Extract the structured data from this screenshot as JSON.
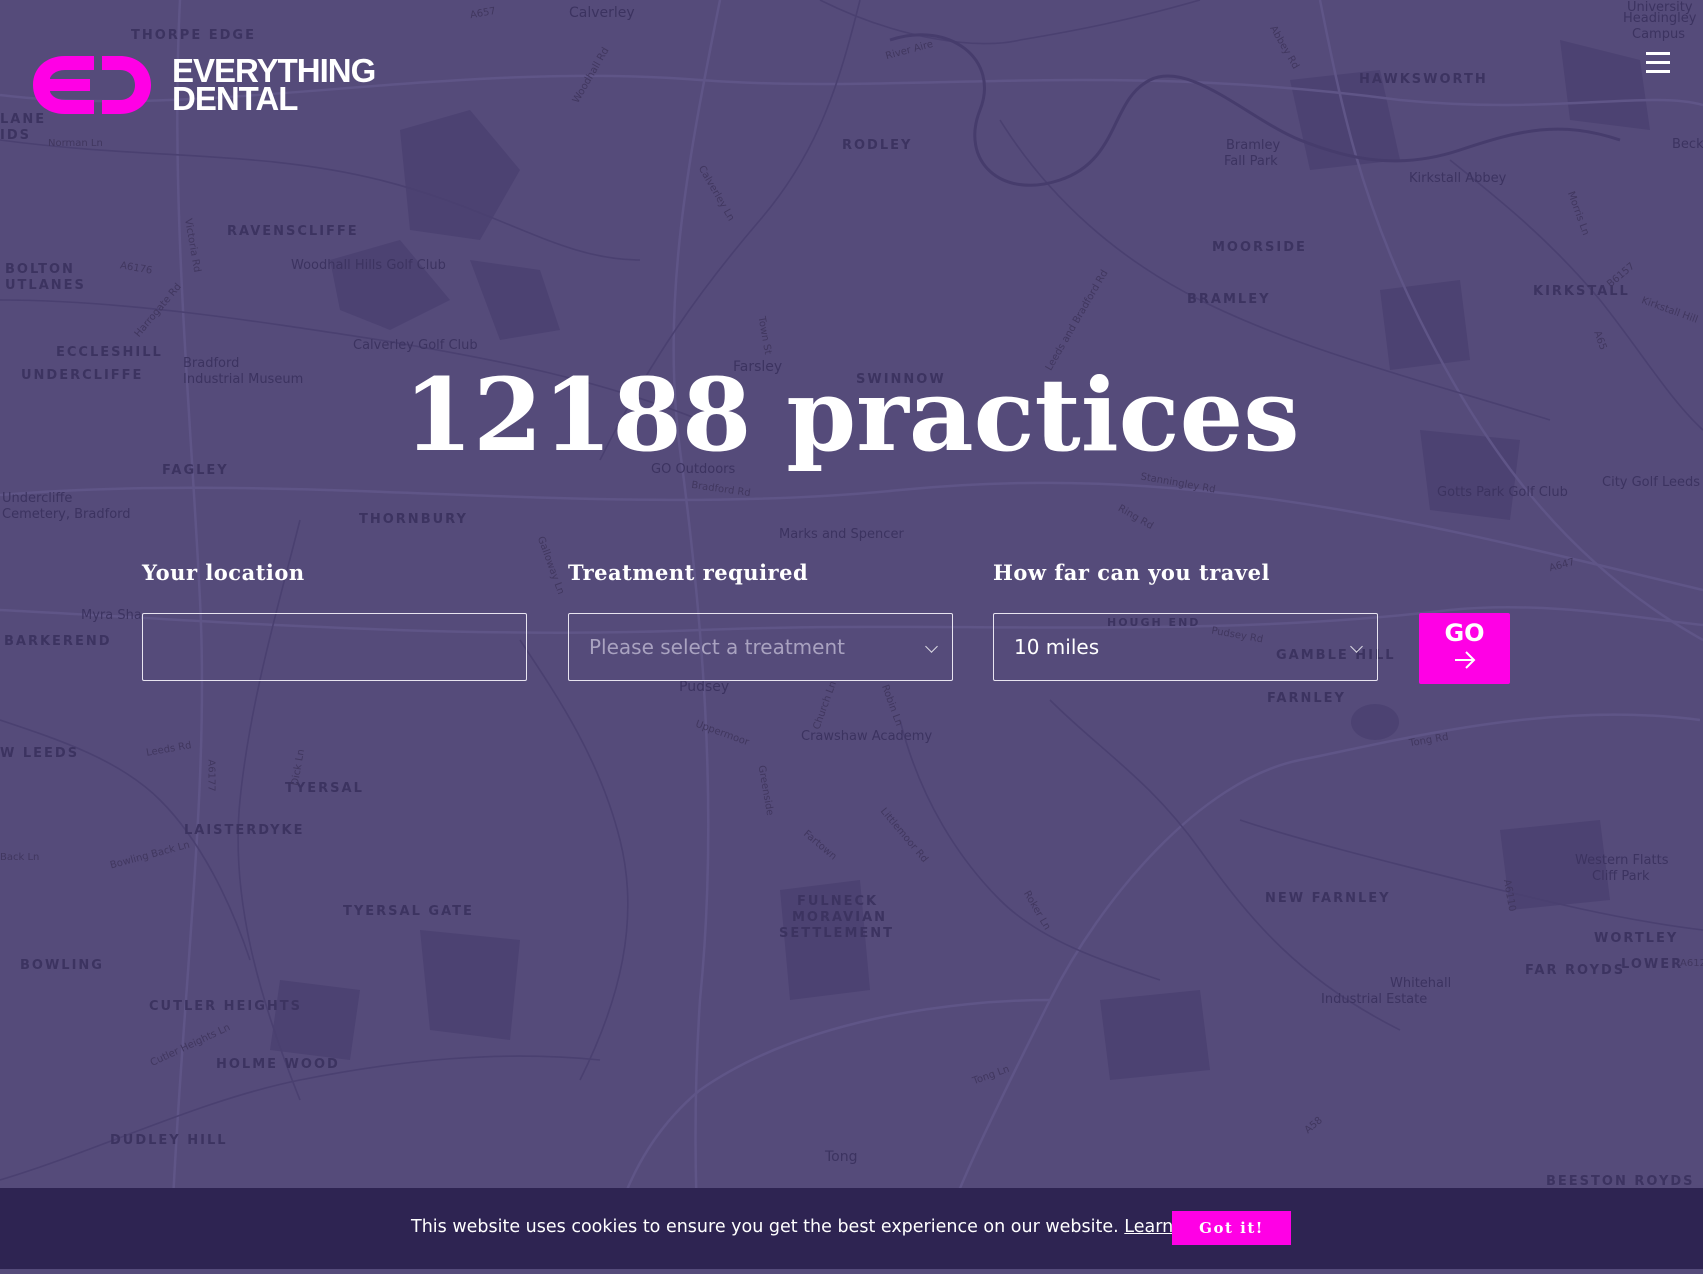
{
  "brand": {
    "logo_line1": "EVERYTHING",
    "logo_line2": "DENTAL",
    "accent_color": "#ff00e5",
    "background_color": "#554b7a",
    "cookie_bar_color": "#2e2452"
  },
  "header": {
    "menu_icon": "hamburger-menu-icon"
  },
  "hero": {
    "headline": "12188 practices"
  },
  "search": {
    "location_label": "Your location",
    "location_value": "",
    "treatment_label": "Treatment required",
    "treatment_placeholder": "Please select a treatment",
    "distance_label": "How far can you travel",
    "distance_value": "10 miles",
    "go_label": "GO",
    "go_icon": "arrow-right-icon"
  },
  "cookie": {
    "message": "This website uses cookies to ensure you get the best experience on our website.",
    "link_text": "Learn more",
    "button_label": "Got it!"
  },
  "map": {
    "places": [
      "THORPE EDGE",
      "Calverley",
      "HAWKSWORTH",
      "RODLEY",
      "RAVENSCLIFFE",
      "BOLTON",
      "UTLANES",
      "MOORSIDE",
      "BRAMLEY",
      "KIRKSTALL",
      "ECCLESHILL",
      "UNDERCLIFFE",
      "SWINNOW",
      "Farsley",
      "FAGLEY",
      "THORNBURY",
      "BARKEREND",
      "HOUGH END",
      "GAMBLE HILL",
      "Pudsey",
      "FARNLEY",
      "W LEEDS",
      "TYERSAL",
      "LAISTERDYKE",
      "FULNECK",
      "MORAVIAN",
      "SETTLEMENT",
      "NEW FARNLEY",
      "TYERSAL GATE",
      "WORTLEY",
      "FAR ROYDS",
      "LOWER",
      "BOWLING",
      "CUTLER HEIGHTS",
      "HOLME WOOD",
      "DUDLEY HILL",
      "Tong",
      "BEESTON ROYDS",
      "LANE",
      "IDS"
    ],
    "pois": [
      "Woodhall Hills Golf Club",
      "Calverley Golf Club",
      "Bradford",
      "Industrial Museum",
      "Bramley",
      "Fall Park",
      "Kirkstall Abbey",
      "GO Outdoors",
      "Marks and Spencer",
      "Gotts Park Golf Club",
      "City Golf Leeds",
      "Undercliffe",
      "Cemetery, Bradford",
      "Myra Sha",
      "Crawshaw Academy",
      "Western Flatts",
      "Cliff Park",
      "Whitehall",
      "Industrial Estate",
      "University",
      "Headingley",
      "Campus",
      "Beck"
    ],
    "roads": [
      "A657",
      "River Aire",
      "Woodhall Rd",
      "Abbey Rd",
      "Norman Ln",
      "Calverley Ln",
      "Victoria Rd",
      "A6176",
      "Harrogate Rd",
      "Town St",
      "Leeds and Bradford Rd",
      "Stanningley Rd",
      "Bradford Rd",
      "Ring Rd",
      "A647",
      "Galloway Ln",
      "Leeds Rd",
      "Tong Rd",
      "Pudsey Rd",
      "A6177",
      "Dick Ln",
      "Church Ln",
      "Robin Ln",
      "Uppermoor",
      "Greenside",
      "Littlemoor Rd",
      "Fartown",
      "Roker Ln",
      "Bowling Back Ln",
      "Cutler Heights Ln",
      "Tong Ln",
      "A58",
      "A6110",
      "A6120",
      "Kirkstall Hill",
      "A65",
      "B6157",
      "Morris Ln",
      "Back Ln"
    ]
  }
}
